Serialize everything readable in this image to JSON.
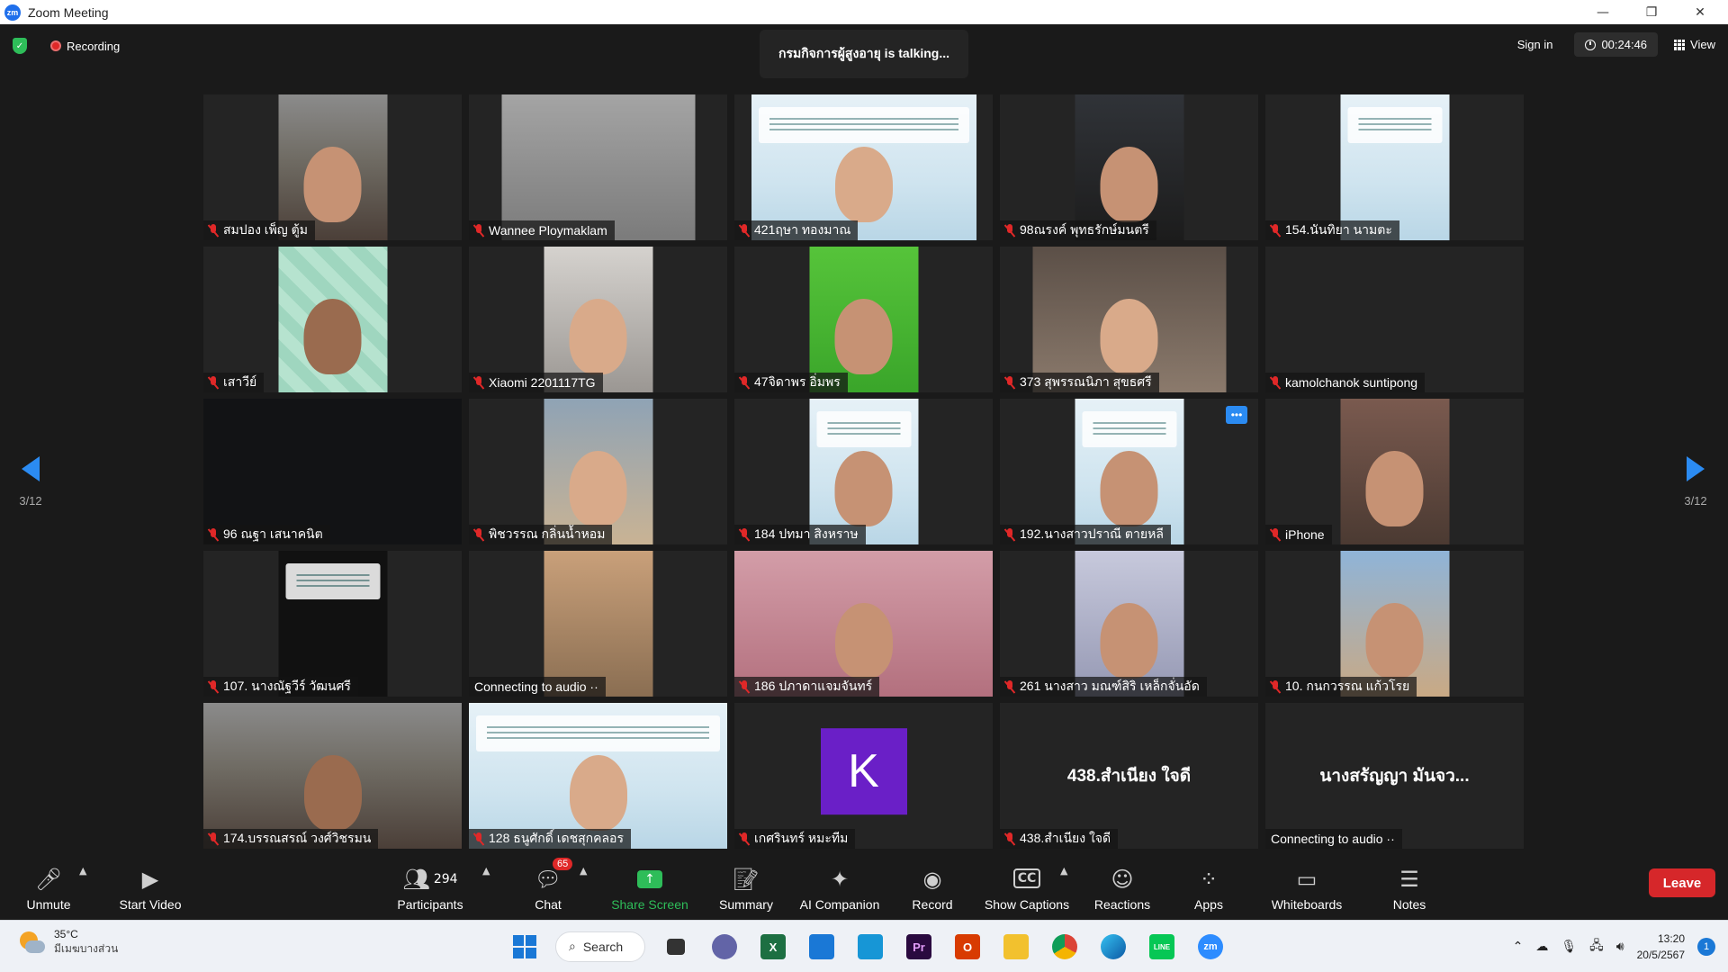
{
  "window": {
    "title": "Zoom Meeting",
    "app_icon_text": "zm",
    "controls": {
      "minimize": "—",
      "restore": "❐",
      "close": "✕"
    }
  },
  "meeting_header": {
    "recording_label": "Recording",
    "talking_text": "กรมกิจการผู้สูงอายุ is talking...",
    "sign_in": "Sign in",
    "timer": "00:24:46",
    "view_label": "View"
  },
  "pagination": {
    "left": "3/12",
    "right": "3/12"
  },
  "tiles": [
    {
      "name": "สมปอง เพ็ญ ตู้ม",
      "muted": true,
      "video": "v-room",
      "w": "w121",
      "face": "face"
    },
    {
      "name": "Wannee Ploymaklam",
      "muted": true,
      "video": "v-grey",
      "w": "w215",
      "face": ""
    },
    {
      "name": "421ฤษา ทองมาณ",
      "muted": true,
      "video": "v-slide",
      "w": "w250",
      "face": "face light",
      "slide": true
    },
    {
      "name": "98ณรงค์ พุทธรักษ์มนตรี",
      "muted": true,
      "video": "v-dark",
      "w": "w121",
      "face": "face"
    },
    {
      "name": "154.นันทิยา นามตะ",
      "muted": true,
      "video": "v-slide",
      "w": "w121",
      "face": "",
      "slide": true
    },
    {
      "name": "เสาวีย์",
      "muted": true,
      "video": "v-tile",
      "w": "w121",
      "face": "face dark"
    },
    {
      "name": "Xiaomi 2201117TG",
      "muted": true,
      "video": "v-white",
      "w": "w121",
      "face": "face light"
    },
    {
      "name": "47จิดาพร อิ่มพร",
      "muted": true,
      "video": "v-green",
      "w": "w121",
      "face": "face"
    },
    {
      "name": "373 สุพรรณนิภา สุขธศรี",
      "muted": true,
      "video": "v-bike",
      "w": "w215",
      "face": "face light"
    },
    {
      "name": "kamolchanok suntipong",
      "muted": true,
      "video": "",
      "w": "",
      "face": ""
    },
    {
      "name": "96 ณฐา เสนาคนิต",
      "muted": true,
      "video": "v-black",
      "w": "full",
      "face": ""
    },
    {
      "name": "พิชวรรณ กลิ่นน้ำหอม",
      "muted": true,
      "video": "v-cafe",
      "w": "w121",
      "face": "face light"
    },
    {
      "name": "184 ปทมา สิงหราษ",
      "muted": true,
      "video": "v-slide",
      "w": "w121",
      "face": "face",
      "slide": true
    },
    {
      "name": "192.นางสาวปราณี ตายหลี",
      "muted": true,
      "video": "v-slide",
      "w": "w121",
      "face": "face",
      "slide": true,
      "more": true
    },
    {
      "name": "iPhone",
      "muted": true,
      "video": "v-warm",
      "w": "w121",
      "face": "face"
    },
    {
      "name": "107. นางณัฐวีร์ วัฒนศรี",
      "muted": true,
      "video": "v-phone",
      "w": "w121",
      "face": "",
      "slide": true
    },
    {
      "name": "Connecting to audio ··",
      "muted": false,
      "video": "v-orange",
      "w": "w121",
      "face": ""
    },
    {
      "name": "186 ปภาดาแจมจันทร์",
      "muted": true,
      "video": "v-pink",
      "w": "full",
      "face": "face"
    },
    {
      "name": "261 นางสาว มณฑ์สิริ เหล็กจั่นอัด",
      "muted": true,
      "video": "v-lav",
      "w": "w121",
      "face": "face"
    },
    {
      "name": "10. กนกวรรณ แก้วโรย",
      "muted": true,
      "video": "v-store",
      "w": "w121",
      "face": "face"
    },
    {
      "name": "174.บรรณสรณ์ วงศ์วิชรมน",
      "muted": true,
      "video": "v-room",
      "w": "full",
      "face": "face dark"
    },
    {
      "name": "128 ธนูศักดิ์ เดชสุกคลอร",
      "muted": true,
      "video": "v-slide",
      "w": "full",
      "face": "face light",
      "slide": true
    },
    {
      "name": "เกศรินทร์ หมะทีม",
      "muted": true,
      "video": "",
      "w": "",
      "face": "",
      "avatar": "K"
    },
    {
      "name": "438.สำเนียง ใจดี",
      "muted": true,
      "video": "",
      "w": "",
      "face": "",
      "center_text": "438.สำเนียง ใจดี"
    },
    {
      "name": "Connecting to audio ··",
      "muted": false,
      "video": "",
      "w": "",
      "face": "",
      "center_text": "นางสรัญญา มันจว..."
    }
  ],
  "toolbar": {
    "unmute": "Unmute",
    "start_video": "Start Video",
    "participants": "Participants",
    "participants_count": "294",
    "chat": "Chat",
    "chat_badge": "65",
    "share_screen": "Share Screen",
    "summary": "Summary",
    "ai_companion": "AI Companion",
    "record": "Record",
    "show_captions": "Show Captions",
    "reactions": "Reactions",
    "apps": "Apps",
    "whiteboards": "Whiteboards",
    "notes": "Notes",
    "leave": "Leave",
    "captions_icon": "CC",
    "share_icon": "↑"
  },
  "taskbar": {
    "temperature": "35°C",
    "condition": "มีเมฆบางส่วน",
    "search": "Search",
    "time": "13:20",
    "date": "20/5/2567",
    "notification_count": "1",
    "apps": [
      "task-view",
      "teams-chat",
      "excel",
      "mail",
      "remote-desktop",
      "premiere",
      "office",
      "file-explorer",
      "chrome",
      "edge",
      "line",
      "zoom"
    ],
    "app_glyphs": {
      "excel": "X",
      "premiere": "Pr",
      "line": "LINE",
      "zoom": "zm",
      "office": "O"
    }
  },
  "colors": {
    "accent_blue": "#2b8bf2",
    "muted_red": "#e02828",
    "share_green": "#2ebd59",
    "leave_red": "#d6272a",
    "avatar_purple": "#6a1fc7"
  }
}
